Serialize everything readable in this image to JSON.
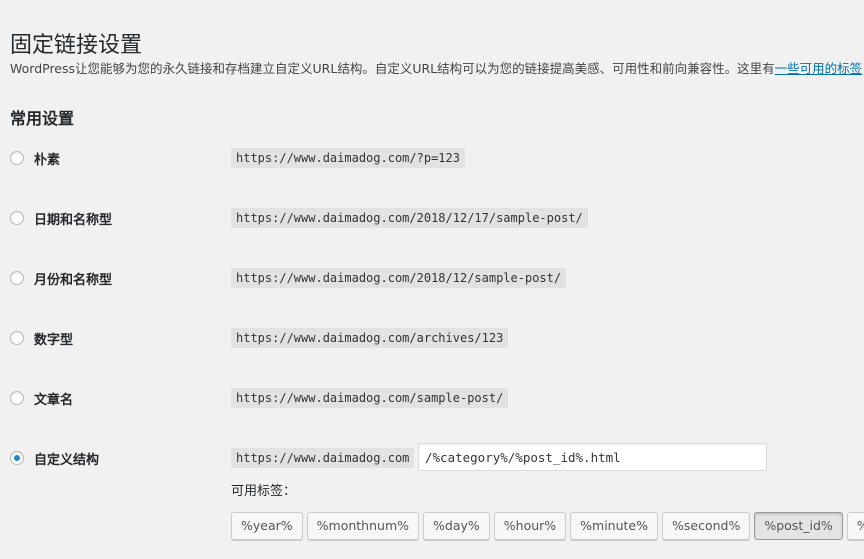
{
  "page": {
    "title": "固定链接设置",
    "intro_text": "WordPress让您能够为您的永久链接和存档建立自定义URL结构。自定义URL结构可以为您的链接提高美感、可用性和前向兼容性。这里有",
    "intro_link": "一些可用的标签"
  },
  "common": {
    "section_title": "常用设置",
    "options": [
      {
        "label": "朴素",
        "example": "https://www.daimadog.com/?p=123",
        "checked": false
      },
      {
        "label": "日期和名称型",
        "example": "https://www.daimadog.com/2018/12/17/sample-post/",
        "checked": false
      },
      {
        "label": "月份和名称型",
        "example": "https://www.daimadog.com/2018/12/sample-post/",
        "checked": false
      },
      {
        "label": "数字型",
        "example": "https://www.daimadog.com/archives/123",
        "checked": false
      },
      {
        "label": "文章名",
        "example": "https://www.daimadog.com/sample-post/",
        "checked": false
      },
      {
        "label": "自定义结构",
        "example": "https://www.daimadog.com",
        "checked": true
      }
    ],
    "custom_structure_value": "/%category%/%post_id%.html",
    "available_tags_label": "可用标签：",
    "tags": [
      {
        "label": "%year%",
        "active": false
      },
      {
        "label": "%monthnum%",
        "active": false
      },
      {
        "label": "%day%",
        "active": false
      },
      {
        "label": "%hour%",
        "active": false
      },
      {
        "label": "%minute%",
        "active": false
      },
      {
        "label": "%second%",
        "active": false
      },
      {
        "label": "%post_id%",
        "active": true
      },
      {
        "label": "%postname%",
        "active": false
      }
    ]
  }
}
